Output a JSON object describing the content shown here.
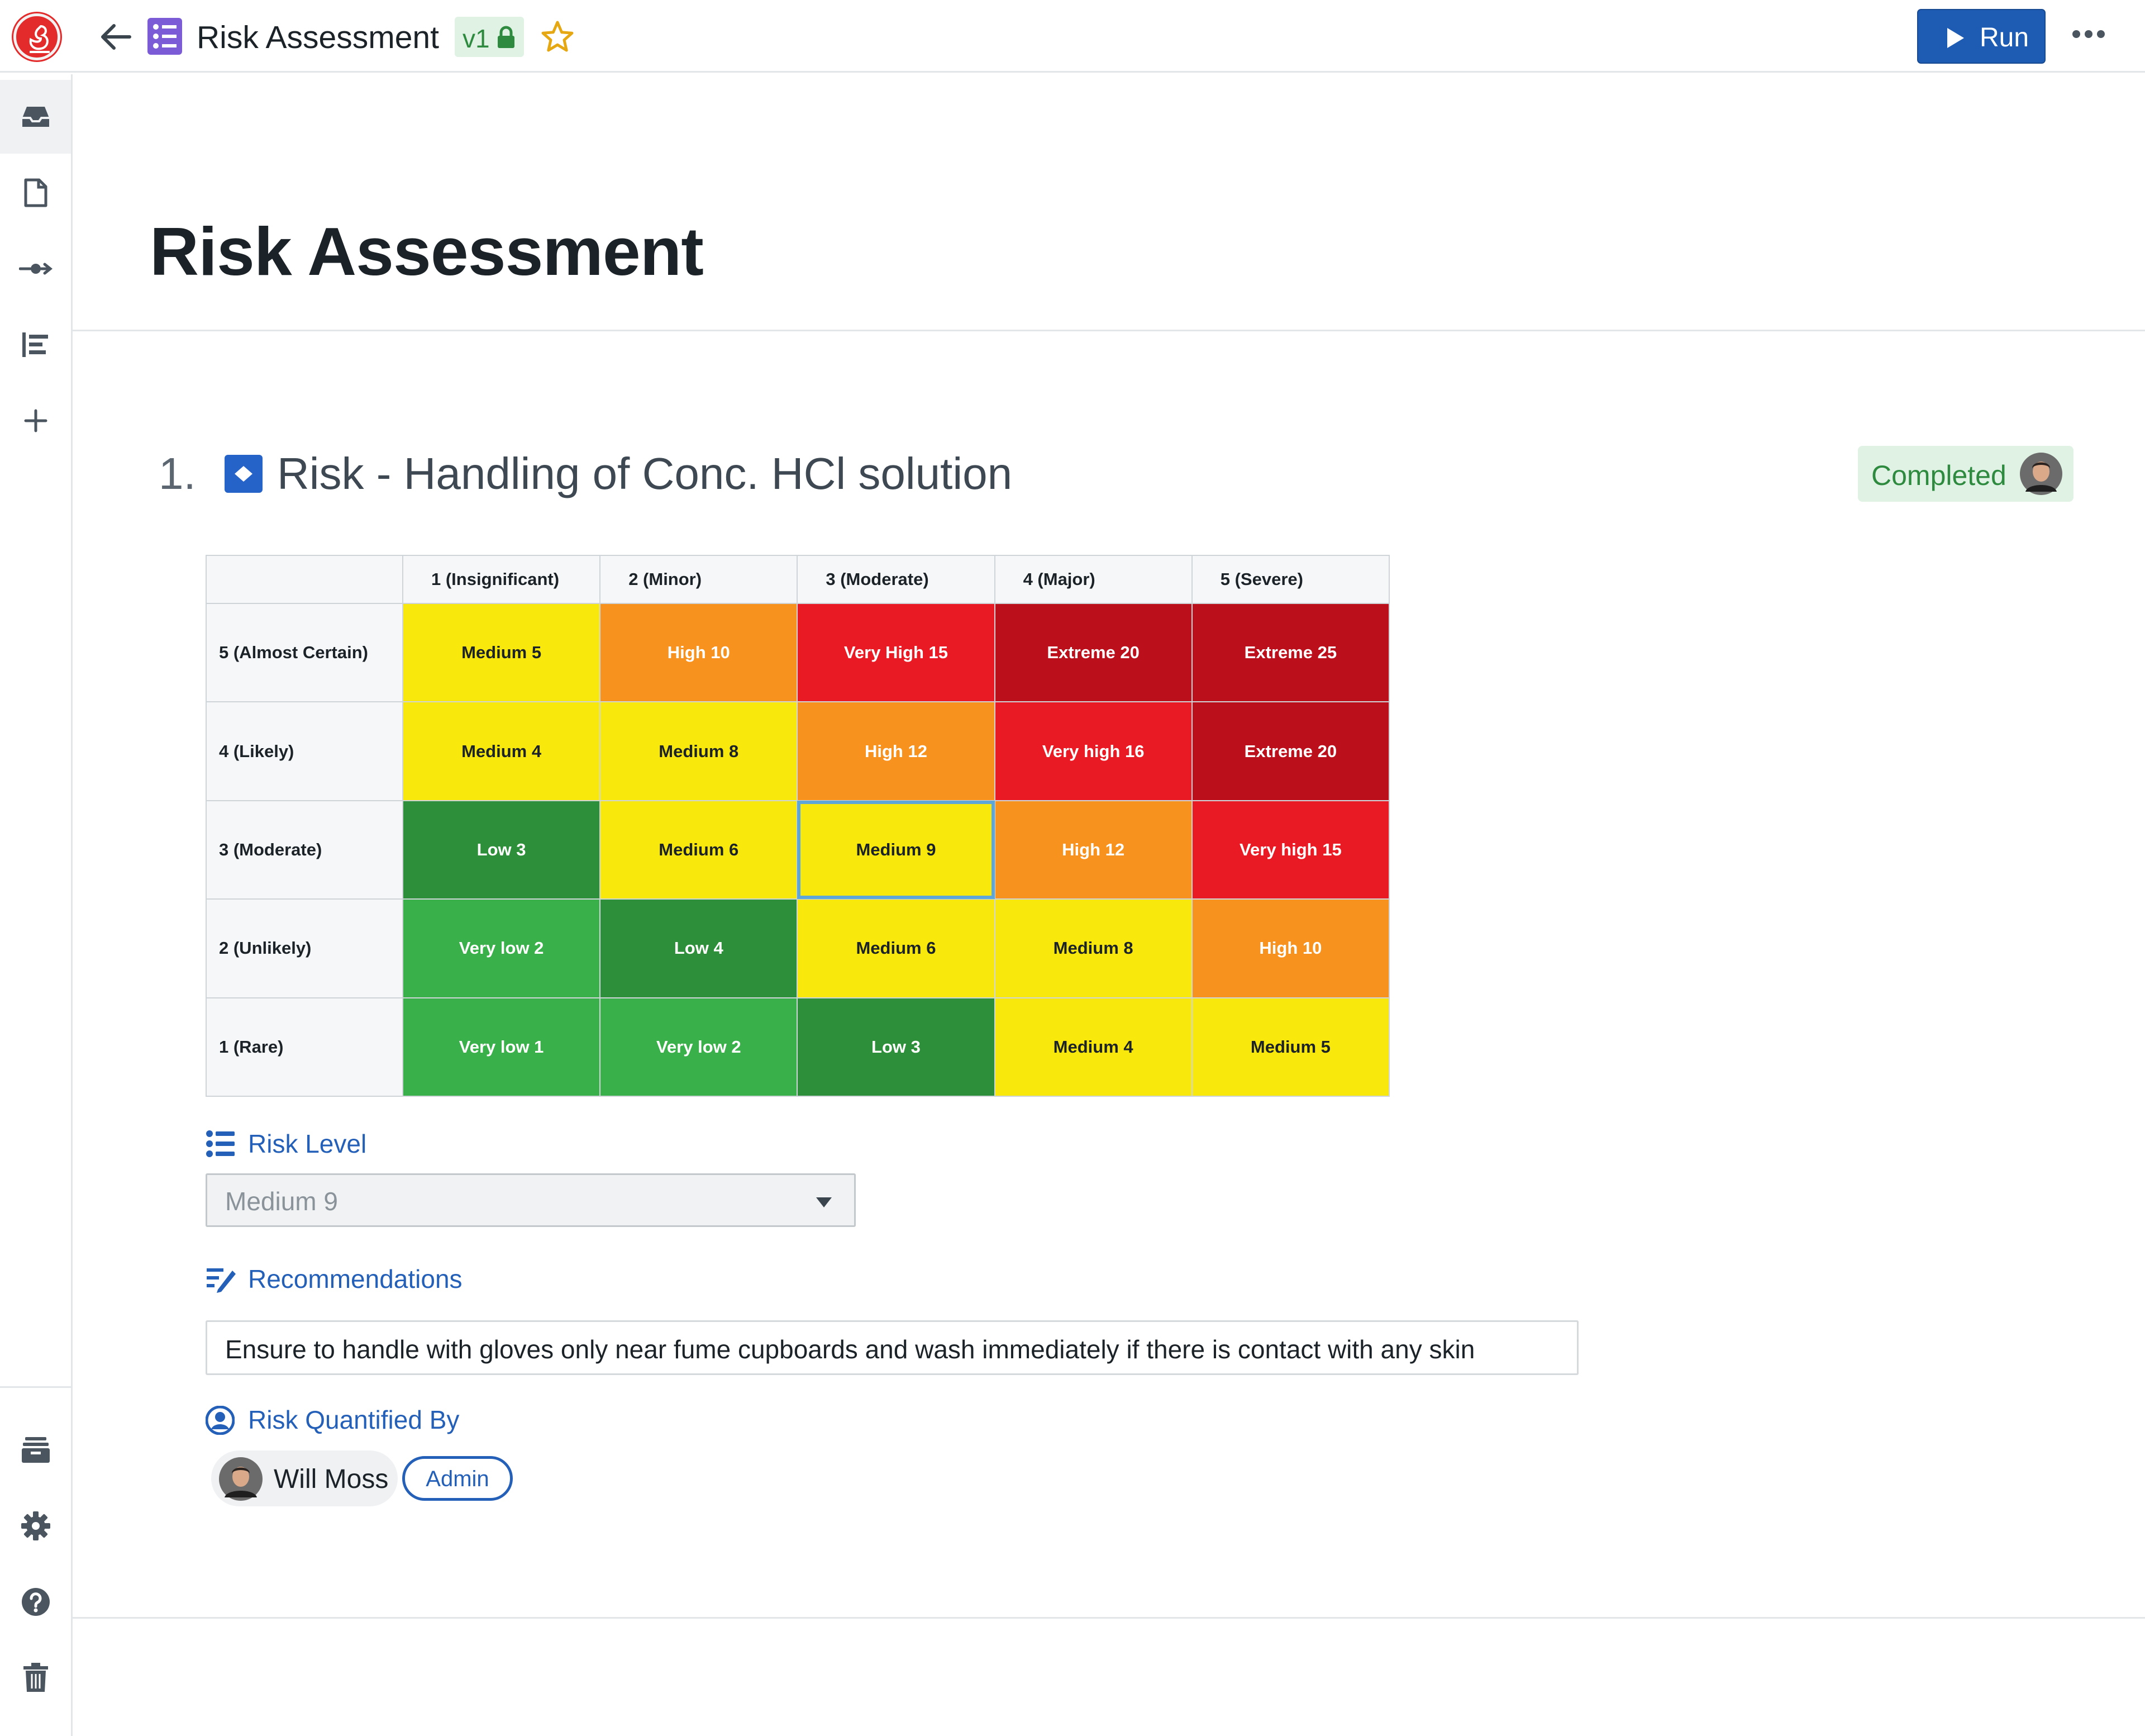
{
  "header": {
    "title": "Risk Assessment",
    "version": "v1",
    "run_label": "Run"
  },
  "page": {
    "title": "Risk Assessment"
  },
  "step": {
    "number": "1.",
    "title": "Risk - Handling of Conc. HCl solution",
    "status": "Completed"
  },
  "matrix": {
    "columns": [
      "1 (Insignificant)",
      "2 (Minor)",
      "3 (Moderate)",
      "4 (Major)",
      "5 (Severe)"
    ],
    "rows": [
      {
        "label": "5 (Almost Certain)",
        "cells": [
          "Medium 5",
          "High 10",
          "Very High 15",
          "Extreme 20",
          "Extreme 25"
        ]
      },
      {
        "label": "4 (Likely)",
        "cells": [
          "Medium 4",
          "Medium 8",
          "High 12",
          "Very high 16",
          "Extreme 20"
        ]
      },
      {
        "label": "3 (Moderate)",
        "cells": [
          "Low 3",
          "Medium 6",
          "Medium 9",
          "High 12",
          "Very high 15"
        ]
      },
      {
        "label": "2 (Unlikely)",
        "cells": [
          "Very low 2",
          "Low 4",
          "Medium 6",
          "Medium 8",
          "High 10"
        ]
      },
      {
        "label": "1 (Rare)",
        "cells": [
          "Very low 1",
          "Very low 2",
          "Low 3",
          "Medium 4",
          "Medium 5"
        ]
      }
    ],
    "selected": "Medium 9",
    "colors": {
      "medium": "#f8e80c",
      "high": "#f7921e",
      "very_high": "#ea1a24",
      "extreme": "#bb101c",
      "very_low": "#39b04a",
      "low": "#2e8f3a",
      "selected_outline": "#5ea5d8"
    }
  },
  "fields": {
    "risk_level": {
      "label": "Risk Level",
      "value": "Medium 9"
    },
    "recommendations": {
      "label": "Recommendations",
      "value": "Ensure to handle with gloves only near fume cupboards and wash immediately if there is contact with any skin"
    },
    "quantified_by": {
      "label": "Risk Quantified By",
      "user": "Will Moss",
      "role": "Admin"
    }
  },
  "icons": {
    "rail": [
      "inbox-icon",
      "document-icon",
      "workflow-icon",
      "list-icon",
      "plus-icon",
      "archive-icon",
      "settings-icon",
      "help-icon",
      "trash-icon"
    ]
  },
  "theme": {
    "accent": "#1e5cb3",
    "success_bg": "#dff2e3",
    "success_text": "#2d8a3e",
    "label_blue": "#2560b8"
  }
}
